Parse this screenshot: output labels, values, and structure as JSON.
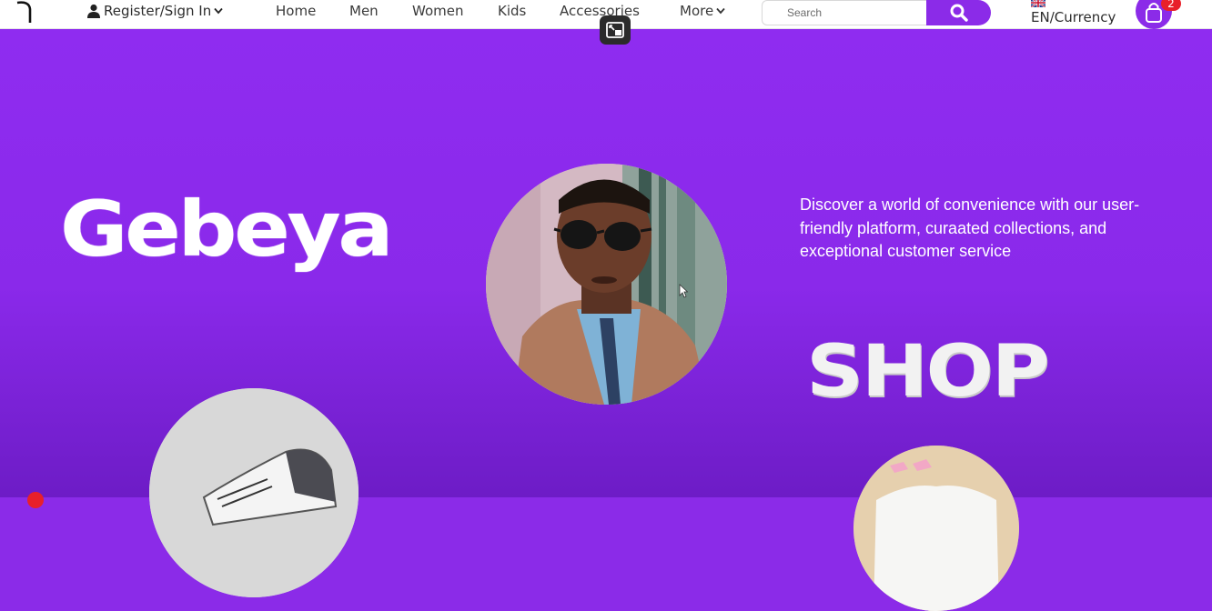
{
  "nav": {
    "register_label": "Register/Sign In",
    "items": [
      {
        "label": "Home"
      },
      {
        "label": "Men"
      },
      {
        "label": "Women"
      },
      {
        "label": "Kids"
      },
      {
        "label": "Accessories"
      },
      {
        "label": "More"
      }
    ],
    "search_placeholder": "Search",
    "currency_label": "EN/Currency",
    "cart_count": "2"
  },
  "hero": {
    "brand": "Gebeya",
    "tagline": "Discover a world of convenience with our user-friendly platform, curaated collections, and exceptional customer service",
    "shop_label": "SHOP"
  },
  "colors": {
    "accent": "#8b2be8",
    "badge": "#e8202a",
    "nav_bg": "#ffffff"
  },
  "icons": [
    "user-icon",
    "chevron-down-icon",
    "search-icon",
    "uk-flag-icon",
    "shopping-bag-icon",
    "picture-in-picture-icon"
  ]
}
